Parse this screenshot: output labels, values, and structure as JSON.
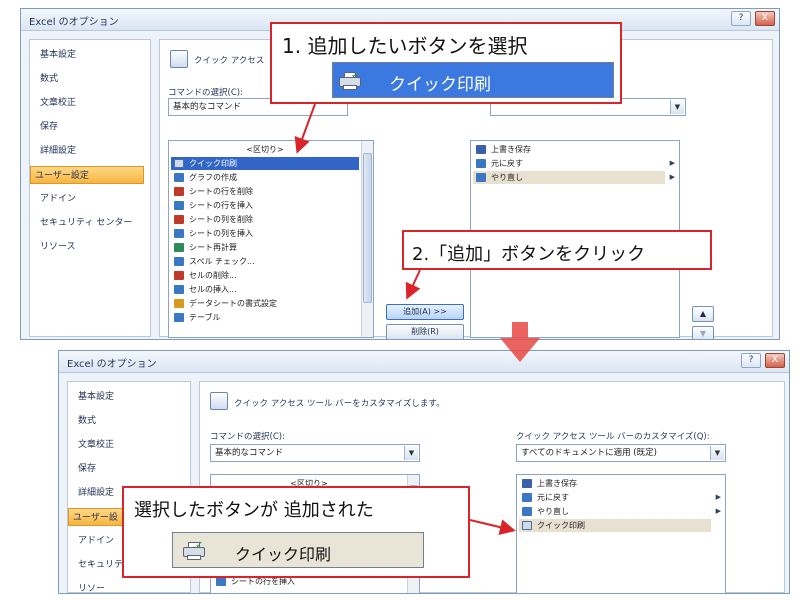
{
  "window": {
    "title": "Excel のオプション",
    "help_label": "?",
    "close_label": "X"
  },
  "nav": {
    "items": [
      "基本設定",
      "数式",
      "文章校正",
      "保存",
      "詳細設定",
      "ユーザー設定",
      "アドイン",
      "セキュリティ センター",
      "リソース"
    ],
    "truncated_items": [
      "基本設定",
      "数式",
      "文章校正",
      "保存",
      "詳細設定",
      "ユーザー設",
      "アドイン",
      "セキュリテ",
      "リソー"
    ]
  },
  "customize": {
    "header": "クイック アクセス ツール バーをカスタマイズします。",
    "header_short": "クイック アクセス",
    "command_label": "コマンドの選択(C):",
    "command_value": "基本的なコマンド",
    "qat_label": "クイック アクセス ツール バーのカスタマイズ(Q):",
    "qat_value": "すべてのドキュメントに適用 (既定)",
    "info_icon": "info-icon"
  },
  "commands": [
    {
      "label": "<区切り>",
      "color": ""
    },
    {
      "label": "クイック印刷",
      "color": "#4a6fa5"
    },
    {
      "label": "グラフの作成",
      "color": "#3b78c4"
    },
    {
      "label": "シートの行を削除",
      "color": "#c0392b"
    },
    {
      "label": "シートの行を挿入",
      "color": "#3b78c4"
    },
    {
      "label": "シートの列を削除",
      "color": "#c0392b"
    },
    {
      "label": "シートの列を挿入",
      "color": "#3b78c4"
    },
    {
      "label": "シート再計算",
      "color": "#2e8b57"
    },
    {
      "label": "スペル チェック...",
      "color": "#3b78c4"
    },
    {
      "label": "セルの削除...",
      "color": "#c0392b"
    },
    {
      "label": "セルの挿入...",
      "color": "#3b78c4"
    },
    {
      "label": "データシートの書式設定",
      "color": "#d79a1e"
    },
    {
      "label": "テーブル",
      "color": "#3b78c4"
    }
  ],
  "bottom_commands": {
    "first": "<区切り>",
    "last": "シートの行を挿入"
  },
  "qat_before": [
    {
      "label": "上書き保存",
      "color": "#3b5fa8"
    },
    {
      "label": "元に戻す",
      "color": "#3b78c4"
    },
    {
      "label": "やり直し",
      "color": "#3b78c4"
    }
  ],
  "qat_after": [
    {
      "label": "上書き保存",
      "color": "#3b5fa8"
    },
    {
      "label": "元に戻す",
      "color": "#3b78c4"
    },
    {
      "label": "やり直し",
      "color": "#3b78c4"
    },
    {
      "label": "クイック印刷",
      "color": "#4a6fa5"
    }
  ],
  "buttons": {
    "add": "追加(A) >>",
    "remove": "削除(R)",
    "up": "▲",
    "down": "▼"
  },
  "callouts": {
    "step1": "1. 追加したいボタンを選択",
    "step1_button": "クイック印刷",
    "step2": "2.「追加」ボタンをクリック",
    "result": "選択したボタンが 追加された",
    "result_button": "クイック印刷"
  },
  "colors": {
    "callout_border": "#d9252a",
    "selection": "#3166c8",
    "nav_active": "#f7b540",
    "arrow": "#e8524f"
  }
}
